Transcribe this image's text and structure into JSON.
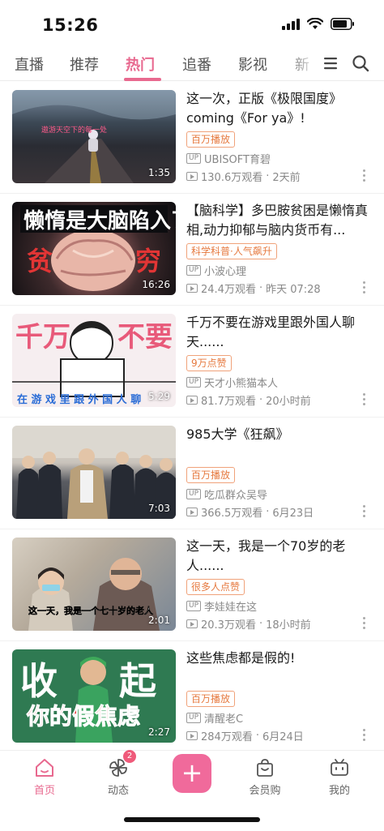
{
  "status_bar": {
    "time": "15:26"
  },
  "top_nav": {
    "tabs": [
      {
        "label": "直播"
      },
      {
        "label": "推荐"
      },
      {
        "label": "热门"
      },
      {
        "label": "追番"
      },
      {
        "label": "影视"
      },
      {
        "label": "新"
      }
    ],
    "active_tab": "热门",
    "accent_color": "#e8698f"
  },
  "videos": [
    {
      "title": "这一次，正版《极限国度》coming《For ya》!",
      "badge": "百万播放",
      "uploader": "UBISOFT育碧",
      "views": "130.6万观看",
      "time": "2天前",
      "duration": "1:35",
      "thumb_caption": "遨游天空下的每一处"
    },
    {
      "title": "【脑科学】多巴胺贫困是懒惰真相,动力抑郁与脑内货币有...",
      "badge": "科学科普·人气飙升",
      "uploader": "小波心理",
      "views": "24.4万观看",
      "time": "昨天 07:28",
      "duration": "16:26",
      "thumb_caption": "懒惰是大脑陷入了",
      "thumb_caption2": "贫 穷"
    },
    {
      "title": "千万不要在游戏里跟外国人聊天......",
      "badge": "9万点赞",
      "uploader": "天才小熊猫本人",
      "views": "81.7万观看",
      "time": "20小时前",
      "duration": "5:29",
      "thumb_caption": "千万  不要",
      "thumb_caption2": "在 游 戏 里 跟 外 国 人 聊 天"
    },
    {
      "title": "985大学《狂飙》",
      "badge": "百万播放",
      "uploader": "吃瓜群众吴导",
      "views": "366.5万观看",
      "time": "6月23日",
      "duration": "7:03"
    },
    {
      "title": "这一天，我是一个70岁的老人......",
      "badge": "很多人点赞",
      "uploader": "李娃娃在这",
      "views": "20.3万观看",
      "time": "18小时前",
      "duration": "2:01",
      "thumb_caption": "这一天，我是一个七十岁的老人"
    },
    {
      "title": "这些焦虑都是假的!",
      "badge": "百万播放",
      "uploader": "清醒老C",
      "views": "284万观看",
      "time": "6月24日",
      "duration": "2:27",
      "thumb_caption": "收 起",
      "thumb_caption2": "你的假焦虑"
    }
  ],
  "bottom_bar": {
    "items": [
      {
        "label": "首页",
        "icon": "home-icon"
      },
      {
        "label": "动态",
        "icon": "pinwheel-icon",
        "badge": "2"
      },
      {
        "label": "+",
        "icon": "plus-icon"
      },
      {
        "label": "会员购",
        "icon": "shopping-bag-icon"
      },
      {
        "label": "我的",
        "icon": "tv-icon"
      }
    ]
  },
  "meta": {
    "up_tag": "UP"
  }
}
